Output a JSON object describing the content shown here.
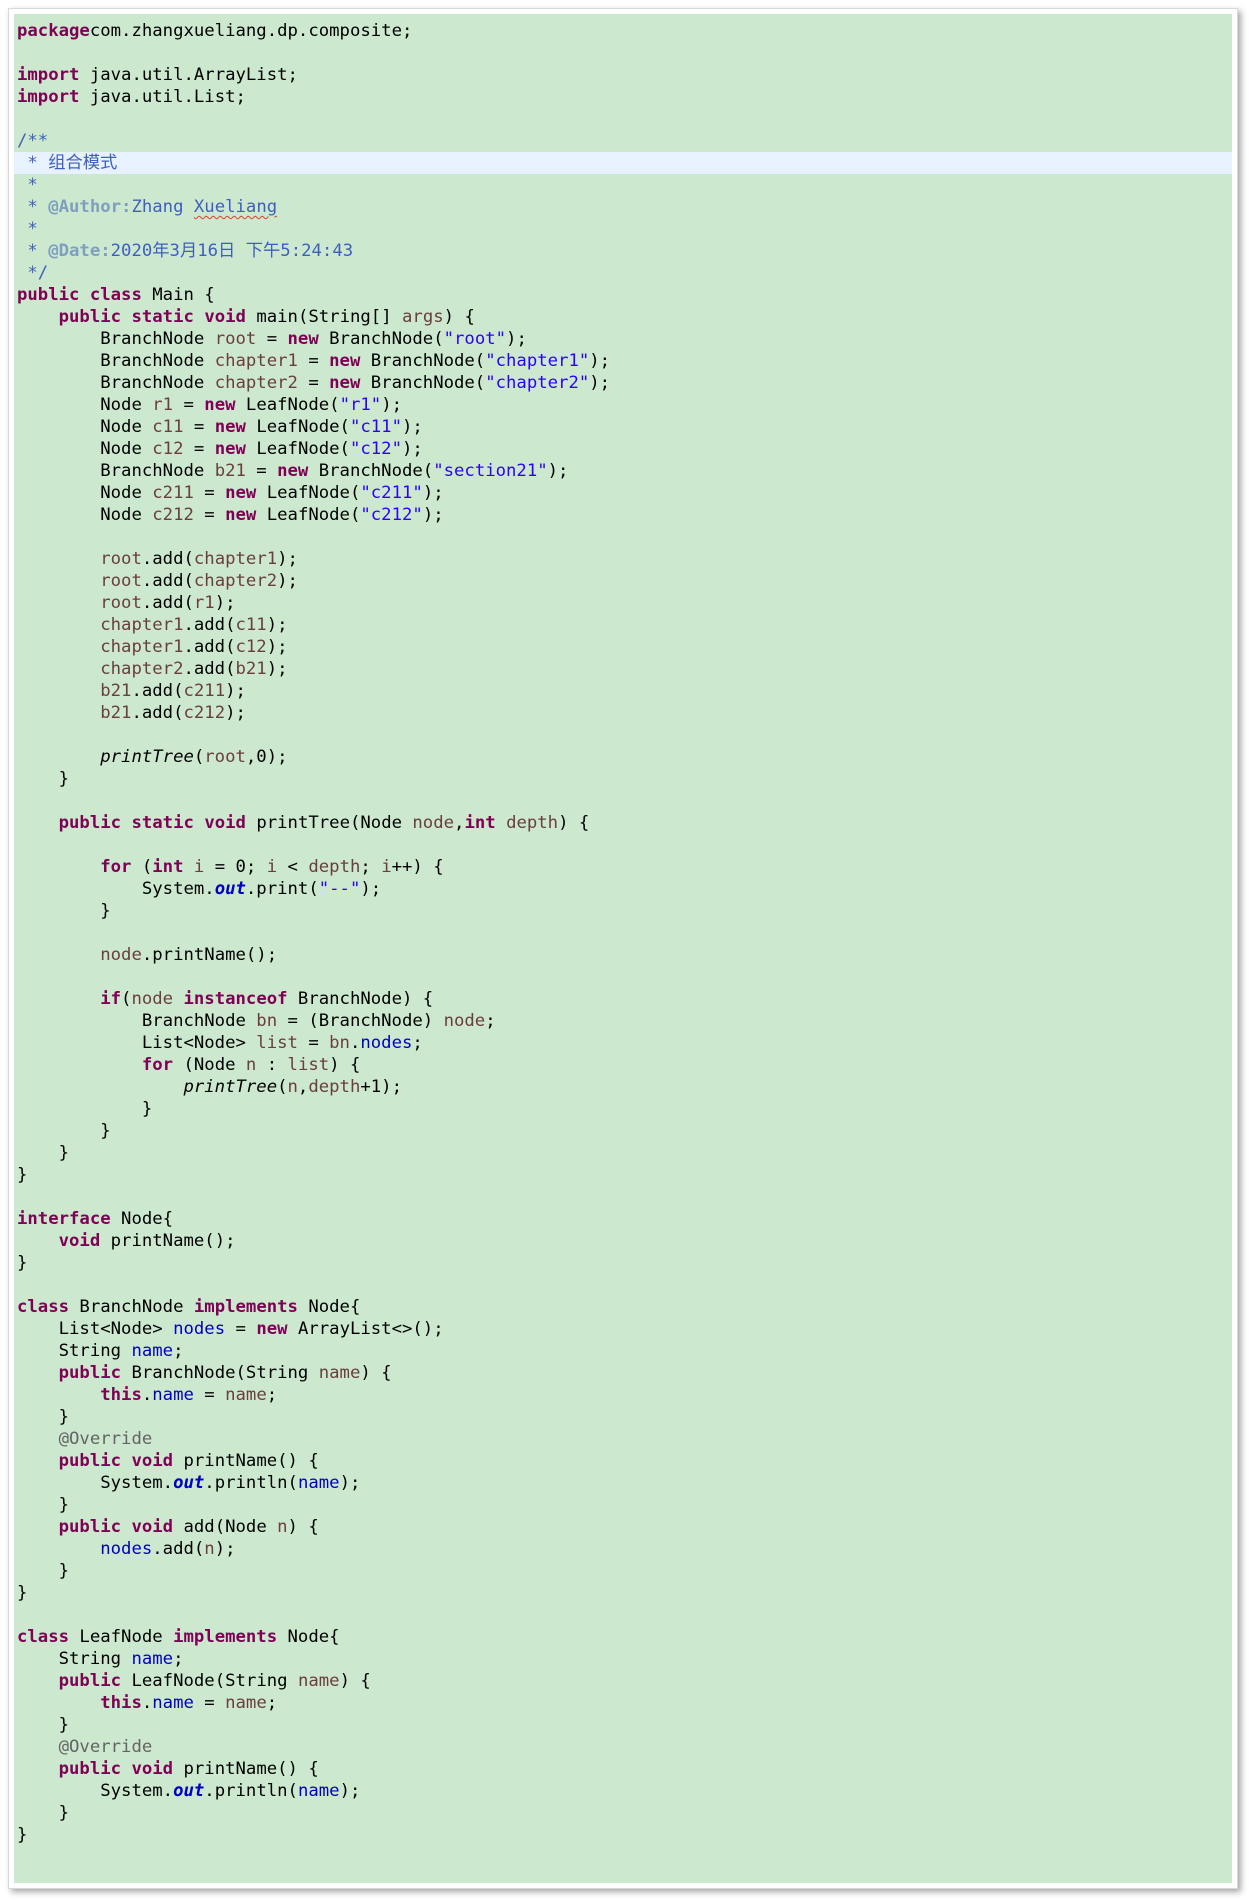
{
  "editor": {
    "background": "#cce8cf",
    "highlighted_line_color": "#e8f2fe",
    "syntax_colors": {
      "keyword": "#7f0055",
      "string": "#2a00ff",
      "field": "#0000c0",
      "local_variable": "#6a3e3e",
      "javadoc": "#3f5fbf",
      "javadoc_tag": "#7f9fbf",
      "annotation": "#646464"
    },
    "highlighted_line_index": 6,
    "lines": [
      [
        [
          "kw",
          "package"
        ],
        [
          "",
          "com.zhangxueliang.dp.composite;"
        ]
      ],
      [],
      [
        [
          "kw",
          "import"
        ],
        [
          "",
          " java.util.ArrayList;"
        ]
      ],
      [
        [
          "kw",
          "import"
        ],
        [
          "",
          " java.util.List;"
        ]
      ],
      [],
      [
        [
          "jd",
          "/**"
        ]
      ],
      [
        [
          "jd",
          " * 组合模式"
        ]
      ],
      [
        [
          "jd",
          " *"
        ]
      ],
      [
        [
          "jd",
          " * "
        ],
        [
          "tag",
          "@Author:"
        ],
        [
          "jd",
          "Zhang "
        ],
        [
          "jd typo",
          "Xueliang"
        ]
      ],
      [
        [
          "jd",
          " *"
        ]
      ],
      [
        [
          "jd",
          " * "
        ],
        [
          "tag",
          "@Date:"
        ],
        [
          "jd",
          "2020年3月16日 下午5:24:43"
        ]
      ],
      [
        [
          "jd",
          " */"
        ]
      ],
      [
        [
          "kw",
          "public"
        ],
        [
          "",
          " "
        ],
        [
          "kw",
          "class"
        ],
        [
          "",
          " Main {"
        ]
      ],
      [
        [
          "",
          "    "
        ],
        [
          "kw",
          "public"
        ],
        [
          "",
          " "
        ],
        [
          "kw",
          "static"
        ],
        [
          "",
          " "
        ],
        [
          "kw",
          "void"
        ],
        [
          "",
          " main(String[] "
        ],
        [
          "var",
          "args"
        ],
        [
          "",
          ") {"
        ]
      ],
      [
        [
          "",
          "        BranchNode "
        ],
        [
          "var",
          "root"
        ],
        [
          "",
          " = "
        ],
        [
          "kw",
          "new"
        ],
        [
          "",
          " BranchNode("
        ],
        [
          "str",
          "\"root\""
        ],
        [
          "",
          ");"
        ]
      ],
      [
        [
          "",
          "        BranchNode "
        ],
        [
          "var",
          "chapter1"
        ],
        [
          "",
          " = "
        ],
        [
          "kw",
          "new"
        ],
        [
          "",
          " BranchNode("
        ],
        [
          "str",
          "\"chapter1\""
        ],
        [
          "",
          ");"
        ]
      ],
      [
        [
          "",
          "        BranchNode "
        ],
        [
          "var",
          "chapter2"
        ],
        [
          "",
          " = "
        ],
        [
          "kw",
          "new"
        ],
        [
          "",
          " BranchNode("
        ],
        [
          "str",
          "\"chapter2\""
        ],
        [
          "",
          ");"
        ]
      ],
      [
        [
          "",
          "        Node "
        ],
        [
          "var",
          "r1"
        ],
        [
          "",
          " = "
        ],
        [
          "kw",
          "new"
        ],
        [
          "",
          " LeafNode("
        ],
        [
          "str",
          "\"r1\""
        ],
        [
          "",
          ");"
        ]
      ],
      [
        [
          "",
          "        Node "
        ],
        [
          "var",
          "c11"
        ],
        [
          "",
          " = "
        ],
        [
          "kw",
          "new"
        ],
        [
          "",
          " LeafNode("
        ],
        [
          "str",
          "\"c11\""
        ],
        [
          "",
          ");"
        ]
      ],
      [
        [
          "",
          "        Node "
        ],
        [
          "var",
          "c12"
        ],
        [
          "",
          " = "
        ],
        [
          "kw",
          "new"
        ],
        [
          "",
          " LeafNode("
        ],
        [
          "str",
          "\"c12\""
        ],
        [
          "",
          ");"
        ]
      ],
      [
        [
          "",
          "        BranchNode "
        ],
        [
          "var",
          "b21"
        ],
        [
          "",
          " = "
        ],
        [
          "kw",
          "new"
        ],
        [
          "",
          " BranchNode("
        ],
        [
          "str",
          "\"section21\""
        ],
        [
          "",
          ");"
        ]
      ],
      [
        [
          "",
          "        Node "
        ],
        [
          "var",
          "c211"
        ],
        [
          "",
          " = "
        ],
        [
          "kw",
          "new"
        ],
        [
          "",
          " LeafNode("
        ],
        [
          "str",
          "\"c211\""
        ],
        [
          "",
          ");"
        ]
      ],
      [
        [
          "",
          "        Node "
        ],
        [
          "var",
          "c212"
        ],
        [
          "",
          " = "
        ],
        [
          "kw",
          "new"
        ],
        [
          "",
          " LeafNode("
        ],
        [
          "str",
          "\"c212\""
        ],
        [
          "",
          ");"
        ]
      ],
      [],
      [
        [
          "",
          "        "
        ],
        [
          "var",
          "root"
        ],
        [
          "",
          ".add("
        ],
        [
          "var",
          "chapter1"
        ],
        [
          "",
          ");"
        ]
      ],
      [
        [
          "",
          "        "
        ],
        [
          "var",
          "root"
        ],
        [
          "",
          ".add("
        ],
        [
          "var",
          "chapter2"
        ],
        [
          "",
          ");"
        ]
      ],
      [
        [
          "",
          "        "
        ],
        [
          "var",
          "root"
        ],
        [
          "",
          ".add("
        ],
        [
          "var",
          "r1"
        ],
        [
          "",
          ");"
        ]
      ],
      [
        [
          "",
          "        "
        ],
        [
          "var",
          "chapter1"
        ],
        [
          "",
          ".add("
        ],
        [
          "var",
          "c11"
        ],
        [
          "",
          ");"
        ]
      ],
      [
        [
          "",
          "        "
        ],
        [
          "var",
          "chapter1"
        ],
        [
          "",
          ".add("
        ],
        [
          "var",
          "c12"
        ],
        [
          "",
          ");"
        ]
      ],
      [
        [
          "",
          "        "
        ],
        [
          "var",
          "chapter2"
        ],
        [
          "",
          ".add("
        ],
        [
          "var",
          "b21"
        ],
        [
          "",
          ");"
        ]
      ],
      [
        [
          "",
          "        "
        ],
        [
          "var",
          "b21"
        ],
        [
          "",
          ".add("
        ],
        [
          "var",
          "c211"
        ],
        [
          "",
          ");"
        ]
      ],
      [
        [
          "",
          "        "
        ],
        [
          "var",
          "b21"
        ],
        [
          "",
          ".add("
        ],
        [
          "var",
          "c212"
        ],
        [
          "",
          ");"
        ]
      ],
      [],
      [
        [
          "",
          "        "
        ],
        [
          "st",
          "printTree"
        ],
        [
          "",
          "("
        ],
        [
          "var",
          "root"
        ],
        [
          "",
          ",0);"
        ]
      ],
      [
        [
          "",
          "    }"
        ]
      ],
      [],
      [
        [
          "",
          "    "
        ],
        [
          "kw",
          "public"
        ],
        [
          "",
          " "
        ],
        [
          "kw",
          "static"
        ],
        [
          "",
          " "
        ],
        [
          "kw",
          "void"
        ],
        [
          "",
          " printTree(Node "
        ],
        [
          "var",
          "node"
        ],
        [
          "",
          ","
        ],
        [
          "kw",
          "int"
        ],
        [
          "",
          " "
        ],
        [
          "var",
          "depth"
        ],
        [
          "",
          ") {"
        ]
      ],
      [],
      [
        [
          "",
          "        "
        ],
        [
          "kw",
          "for"
        ],
        [
          "",
          " ("
        ],
        [
          "kw",
          "int"
        ],
        [
          "",
          " "
        ],
        [
          "var",
          "i"
        ],
        [
          "",
          " = 0; "
        ],
        [
          "var",
          "i"
        ],
        [
          "",
          " < "
        ],
        [
          "var",
          "depth"
        ],
        [
          "",
          "; "
        ],
        [
          "var",
          "i"
        ],
        [
          "",
          "++) {"
        ]
      ],
      [
        [
          "",
          "            System."
        ],
        [
          "sfld",
          "out"
        ],
        [
          "",
          ".print("
        ],
        [
          "str",
          "\"--\""
        ],
        [
          "",
          ");"
        ]
      ],
      [
        [
          "",
          "        }"
        ]
      ],
      [],
      [
        [
          "",
          "        "
        ],
        [
          "var",
          "node"
        ],
        [
          "",
          ".printName();"
        ]
      ],
      [],
      [
        [
          "",
          "        "
        ],
        [
          "kw",
          "if"
        ],
        [
          "",
          "("
        ],
        [
          "var",
          "node"
        ],
        [
          "",
          " "
        ],
        [
          "kw",
          "instanceof"
        ],
        [
          "",
          " BranchNode) {"
        ]
      ],
      [
        [
          "",
          "            BranchNode "
        ],
        [
          "var",
          "bn"
        ],
        [
          "",
          " = (BranchNode) "
        ],
        [
          "var",
          "node"
        ],
        [
          "",
          ";"
        ]
      ],
      [
        [
          "",
          "            List<Node> "
        ],
        [
          "var",
          "list"
        ],
        [
          "",
          " = "
        ],
        [
          "var",
          "bn"
        ],
        [
          "",
          "."
        ],
        [
          "fld",
          "nodes"
        ],
        [
          "",
          ";"
        ]
      ],
      [
        [
          "",
          "            "
        ],
        [
          "kw",
          "for"
        ],
        [
          "",
          " (Node "
        ],
        [
          "var",
          "n"
        ],
        [
          "",
          " : "
        ],
        [
          "var",
          "list"
        ],
        [
          "",
          ") {"
        ]
      ],
      [
        [
          "",
          "                "
        ],
        [
          "st",
          "printTree"
        ],
        [
          "",
          "("
        ],
        [
          "var",
          "n"
        ],
        [
          "",
          ","
        ],
        [
          "var",
          "depth"
        ],
        [
          "",
          "+1);"
        ]
      ],
      [
        [
          "",
          "            }"
        ]
      ],
      [
        [
          "",
          "        }"
        ]
      ],
      [
        [
          "",
          "    }"
        ]
      ],
      [
        [
          "",
          "}"
        ]
      ],
      [],
      [
        [
          "kw",
          "interface"
        ],
        [
          "",
          " Node{"
        ]
      ],
      [
        [
          "",
          "    "
        ],
        [
          "kw",
          "void"
        ],
        [
          "",
          " printName();"
        ]
      ],
      [
        [
          "",
          "}"
        ]
      ],
      [],
      [
        [
          "kw",
          "class"
        ],
        [
          "",
          " BranchNode "
        ],
        [
          "kw",
          "implements"
        ],
        [
          "",
          " Node{"
        ]
      ],
      [
        [
          "",
          "    List<Node> "
        ],
        [
          "fld",
          "nodes"
        ],
        [
          "",
          " = "
        ],
        [
          "kw",
          "new"
        ],
        [
          "",
          " ArrayList<>();"
        ]
      ],
      [
        [
          "",
          "    String "
        ],
        [
          "fld",
          "name"
        ],
        [
          "",
          ";"
        ]
      ],
      [
        [
          "",
          "    "
        ],
        [
          "kw",
          "public"
        ],
        [
          "",
          " BranchNode(String "
        ],
        [
          "var",
          "name"
        ],
        [
          "",
          ") {"
        ]
      ],
      [
        [
          "",
          "        "
        ],
        [
          "kw",
          "this"
        ],
        [
          "",
          "."
        ],
        [
          "fld",
          "name"
        ],
        [
          "",
          " = "
        ],
        [
          "var",
          "name"
        ],
        [
          "",
          ";"
        ]
      ],
      [
        [
          "",
          "    }"
        ]
      ],
      [
        [
          "",
          "    "
        ],
        [
          "ann",
          "@Override"
        ]
      ],
      [
        [
          "",
          "    "
        ],
        [
          "kw",
          "public"
        ],
        [
          "",
          " "
        ],
        [
          "kw",
          "void"
        ],
        [
          "",
          " printName() {"
        ]
      ],
      [
        [
          "",
          "        System."
        ],
        [
          "sfld",
          "out"
        ],
        [
          "",
          ".println("
        ],
        [
          "fld",
          "name"
        ],
        [
          "",
          ");"
        ]
      ],
      [
        [
          "",
          "    }"
        ]
      ],
      [
        [
          "",
          "    "
        ],
        [
          "kw",
          "public"
        ],
        [
          "",
          " "
        ],
        [
          "kw",
          "void"
        ],
        [
          "",
          " add(Node "
        ],
        [
          "var",
          "n"
        ],
        [
          "",
          ") {"
        ]
      ],
      [
        [
          "",
          "        "
        ],
        [
          "fld",
          "nodes"
        ],
        [
          "",
          ".add("
        ],
        [
          "var",
          "n"
        ],
        [
          "",
          ");"
        ]
      ],
      [
        [
          "",
          "    }"
        ]
      ],
      [
        [
          "",
          "}"
        ]
      ],
      [],
      [
        [
          "kw",
          "class"
        ],
        [
          "",
          " LeafNode "
        ],
        [
          "kw",
          "implements"
        ],
        [
          "",
          " Node{"
        ]
      ],
      [
        [
          "",
          "    String "
        ],
        [
          "fld",
          "name"
        ],
        [
          "",
          ";"
        ]
      ],
      [
        [
          "",
          "    "
        ],
        [
          "kw",
          "public"
        ],
        [
          "",
          " LeafNode(String "
        ],
        [
          "var",
          "name"
        ],
        [
          "",
          ") {"
        ]
      ],
      [
        [
          "",
          "        "
        ],
        [
          "kw",
          "this"
        ],
        [
          "",
          "."
        ],
        [
          "fld",
          "name"
        ],
        [
          "",
          " = "
        ],
        [
          "var",
          "name"
        ],
        [
          "",
          ";"
        ]
      ],
      [
        [
          "",
          "    }"
        ]
      ],
      [
        [
          "",
          "    "
        ],
        [
          "ann",
          "@Override"
        ]
      ],
      [
        [
          "",
          "    "
        ],
        [
          "kw",
          "public"
        ],
        [
          "",
          " "
        ],
        [
          "kw",
          "void"
        ],
        [
          "",
          " printName() {"
        ]
      ],
      [
        [
          "",
          "        System."
        ],
        [
          "sfld",
          "out"
        ],
        [
          "",
          ".println("
        ],
        [
          "fld",
          "name"
        ],
        [
          "",
          ");"
        ]
      ],
      [
        [
          "",
          "    }"
        ]
      ],
      [
        [
          "",
          "}"
        ]
      ]
    ]
  }
}
